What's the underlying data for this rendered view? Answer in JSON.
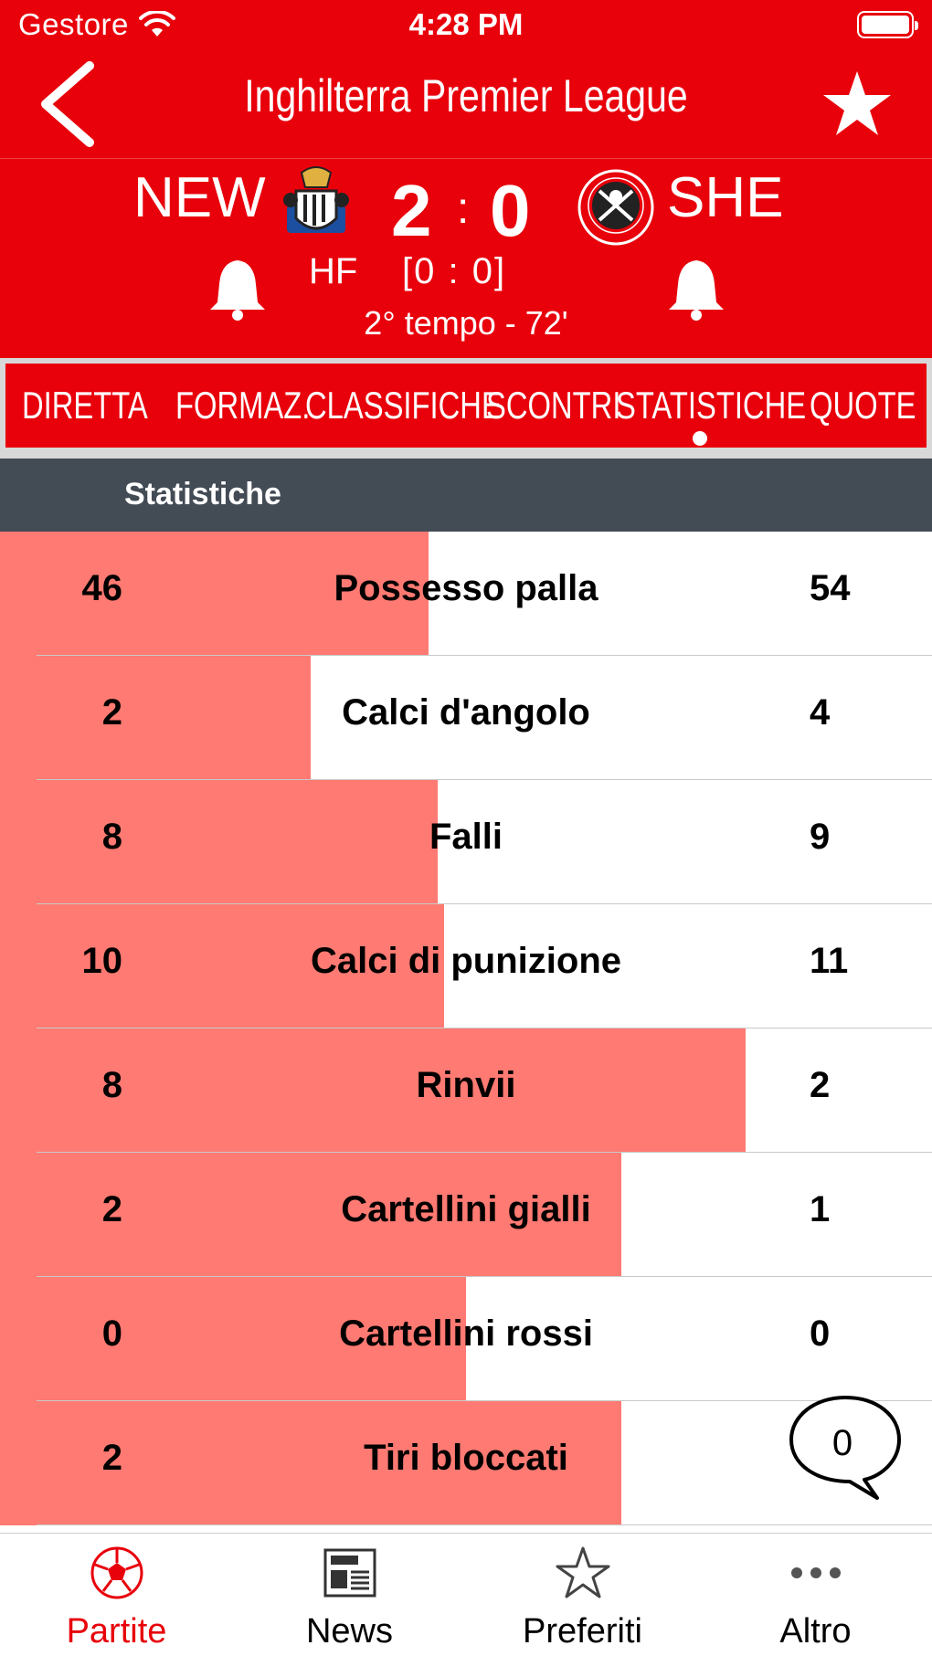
{
  "status_bar": {
    "carrier": "Gestore",
    "time": "4:28 PM"
  },
  "header": {
    "title": "Inghilterra Premier League"
  },
  "match": {
    "home_abbr": "NEW",
    "away_abbr": "SHE",
    "home_score": "2",
    "away_score": "0",
    "separator": ":",
    "ht_label": "HF",
    "ht_score": "[0 : 0]",
    "status": "2° tempo - 72'"
  },
  "tabs": [
    "DIRETTA",
    "FORMAZ.",
    "CLASSIFICHE",
    "SCONTRI",
    "STATISTICHE",
    "QUOTE"
  ],
  "active_tab": "STATISTICHE",
  "section": {
    "title": "Statistiche"
  },
  "stats": [
    {
      "home": "46",
      "label": "Possesso palla",
      "away": "54",
      "home_share": 0.46
    },
    {
      "home": "2",
      "label": "Calci d'angolo",
      "away": "4",
      "home_share": 0.333
    },
    {
      "home": "8",
      "label": "Falli",
      "away": "9",
      "home_share": 0.47
    },
    {
      "home": "10",
      "label": "Calci di punizione",
      "away": "11",
      "home_share": 0.476
    },
    {
      "home": "8",
      "label": "Rinvii",
      "away": "2",
      "home_share": 0.8
    },
    {
      "home": "2",
      "label": "Cartellini gialli",
      "away": "1",
      "home_share": 0.667
    },
    {
      "home": "0",
      "label": "Cartellini rossi",
      "away": "0",
      "home_share": 0.5
    },
    {
      "home": "2",
      "label": "Tiri bloccati",
      "away": "",
      "home_share": 0.667
    }
  ],
  "chat": {
    "count": "0"
  },
  "tabbar": [
    {
      "label": "Partite",
      "icon": "soccer-ball-icon",
      "active": true
    },
    {
      "label": "News",
      "icon": "newspaper-icon",
      "active": false
    },
    {
      "label": "Preferiti",
      "icon": "star-outline-icon",
      "active": false
    },
    {
      "label": "Altro",
      "icon": "more-dots-icon",
      "active": false
    }
  ],
  "colors": {
    "brand_red": "#e8000b",
    "stat_fill": "#ff7a72",
    "section_bg": "#434b55",
    "tab_active": "#e8000b"
  }
}
